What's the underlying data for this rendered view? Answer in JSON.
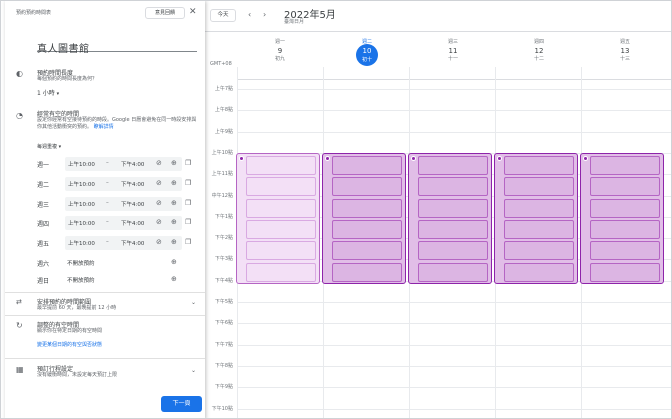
{
  "panel": {
    "header_label": "預約預約時間表",
    "feedback_label": "意見回饋",
    "close_icon": "close-icon",
    "title_value": "真人圖書館",
    "duration": {
      "title": "預約時間長度",
      "subtitle": "每個預約的時間長度為何？",
      "value": "1 小時"
    },
    "availability": {
      "title": "經常有空的時間",
      "subtitle": "設定你經常有空接待預約的時段。Google 日曆會避免在同一時段安排與你其他活動衝突的預約。",
      "link": "瞭解詳情",
      "repeat": "每週重複"
    },
    "days": [
      {
        "label": "週一",
        "start": "上午10:00",
        "end": "下午4:00"
      },
      {
        "label": "週二",
        "start": "上午10:00",
        "end": "下午4:00"
      },
      {
        "label": "週三",
        "start": "上午10:00",
        "end": "下午4:00"
      },
      {
        "label": "週四",
        "start": "上午10:00",
        "end": "下午4:00"
      },
      {
        "label": "週五",
        "start": "上午10:00",
        "end": "下午4:00"
      },
      {
        "label": "週六",
        "status": "不開放預約"
      },
      {
        "label": "週日",
        "status": "不開放預約"
      }
    ],
    "window": {
      "title": "安排預約的時間範圍",
      "subtitle": "最早提前 60 天，最晚提前 12 小時"
    },
    "adjusted": {
      "title": "調整的有空時間",
      "subtitle": "顯示你在特定日期的有空時間",
      "link": "變更某個日期的有空與否狀態"
    },
    "settings": {
      "title": "預訂行程設定",
      "subtitle": "沒有緩衝時間，未設定每天預訂上限"
    },
    "next_label": "下一頁"
  },
  "calendar": {
    "today_label": "今天",
    "month_title": "2022年5月",
    "tz_label": "臺灣日月",
    "gmt_label": "GMT+08",
    "days": [
      {
        "wd": "週一",
        "dn": "9",
        "lunar": "初九"
      },
      {
        "wd": "週二",
        "dn": "10",
        "lunar": "初十"
      },
      {
        "wd": "週三",
        "dn": "11",
        "lunar": "十一"
      },
      {
        "wd": "週四",
        "dn": "12",
        "lunar": "十二"
      },
      {
        "wd": "週五",
        "dn": "13",
        "lunar": "十三"
      }
    ],
    "hours": [
      "上午7點",
      "上午8點",
      "上午9點",
      "上午10點",
      "上午11點",
      "中午12點",
      "下午1點",
      "下午2點",
      "下午3點",
      "下午4點",
      "下午5點",
      "下午6點",
      "下午7點",
      "下午8點",
      "下午9點",
      "下午10點"
    ],
    "accent_color": "#1a73e8",
    "slot_color": "#8e24aa"
  }
}
